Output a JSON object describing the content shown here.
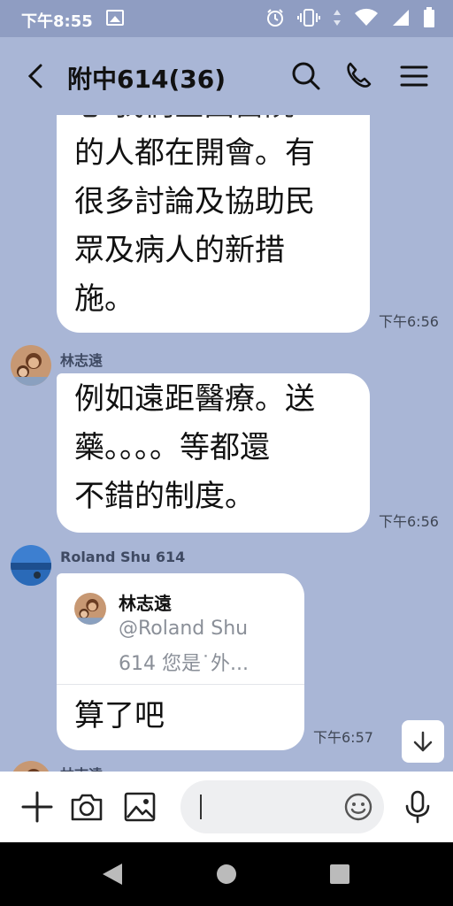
{
  "status_bar": {
    "time": "下午8:55"
  },
  "header": {
    "title": "附中614(36)"
  },
  "messages": [
    {
      "text": "的人都在開會。有\n很多討論及協助民\n眾及病人的新措\n施。",
      "partial_top_text": "心 我們全國醫院",
      "timestamp": "下午6:56"
    },
    {
      "sender": "林志遠",
      "text": "例如遠距醫療。送\n藥。。。。等都還\n不錯的制度。",
      "timestamp": "下午6:56"
    },
    {
      "sender": "Roland Shu 614",
      "reply_to": {
        "name": "林志遠",
        "quote_line1": "@Roland Shu",
        "quote_line2": "614 您是˙外..."
      },
      "text": "算了吧",
      "timestamp": "下午6:57"
    },
    {
      "sender": "林志遠"
    }
  ],
  "input": {
    "placeholder": ""
  },
  "icons": {
    "back": "chevron-left-icon",
    "search": "search-icon",
    "call": "phone-icon",
    "menu": "menu-icon",
    "add": "plus-icon",
    "camera": "camera-icon",
    "gallery": "image-icon",
    "emoji": "emoji-icon",
    "mic": "mic-icon",
    "scroll": "arrow-down-icon"
  },
  "colors": {
    "chat_background": "#a9b6d6",
    "bubble": "#ffffff",
    "status_bar": "#8f9dc2"
  }
}
